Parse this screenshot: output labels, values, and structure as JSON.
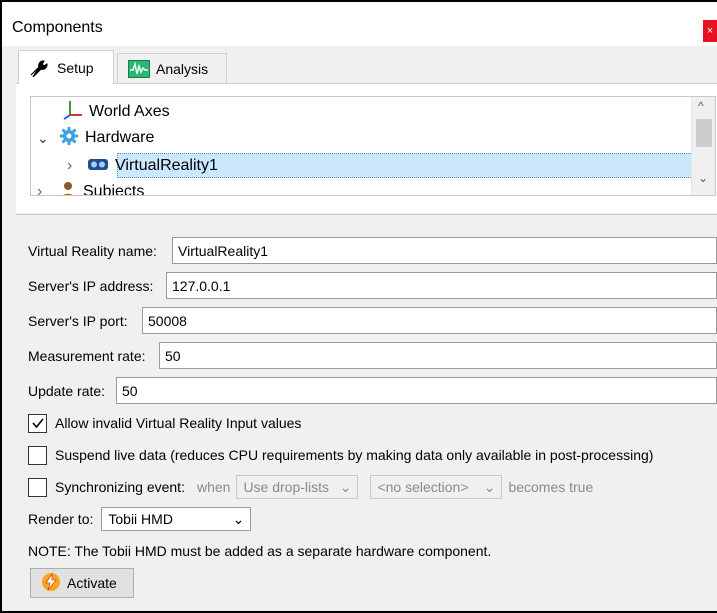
{
  "window": {
    "title": "Components",
    "close_glyph": "×"
  },
  "tabs": [
    {
      "label": "Setup",
      "icon": "wrench-icon",
      "active": true
    },
    {
      "label": "Analysis",
      "icon": "waveform-icon",
      "active": false
    }
  ],
  "tree": {
    "items": [
      {
        "label": "World Axes",
        "icon": "axes-icon",
        "expander": ""
      },
      {
        "label": "Hardware",
        "icon": "gear-icon",
        "expander": "⌄"
      },
      {
        "label": "VirtualReality1",
        "icon": "vr-headset-icon",
        "expander": "›",
        "selected": true
      },
      {
        "label": "Subjects",
        "icon": "person-icon",
        "expander": "›"
      }
    ],
    "scroll_up": "^",
    "scroll_down": "⌄"
  },
  "form": {
    "vr_name_label": "Virtual Reality name:",
    "vr_name_value": "VirtualReality1",
    "ip_address_label": "Server's IP address:",
    "ip_address_value": "127.0.0.1",
    "ip_port_label": "Server's IP port:",
    "ip_port_value": "50008",
    "measurement_rate_label": "Measurement rate:",
    "measurement_rate_value": "50",
    "update_rate_label": "Update rate:",
    "update_rate_value": "50",
    "allow_invalid_label": "Allow invalid Virtual Reality Input values",
    "allow_invalid_checked": true,
    "suspend_label": "Suspend live data (reduces CPU requirements by making data only available in post-processing)",
    "suspend_checked": false,
    "sync_label": "Synchronizing event:",
    "sync_checked": false,
    "sync_when": "when",
    "sync_droplist_value": "Use drop-lists",
    "sync_selection_value": "<no selection>",
    "sync_becomes": "becomes true",
    "render_to_label": "Render to:",
    "render_to_value": "Tobii HMD",
    "note": "NOTE: The Tobii HMD must be added as a separate hardware component.",
    "activate_label": "Activate"
  },
  "colors": {
    "selection": "#cce8ff",
    "accent_close": "#e81123",
    "activate_icon": "#f5a623"
  }
}
